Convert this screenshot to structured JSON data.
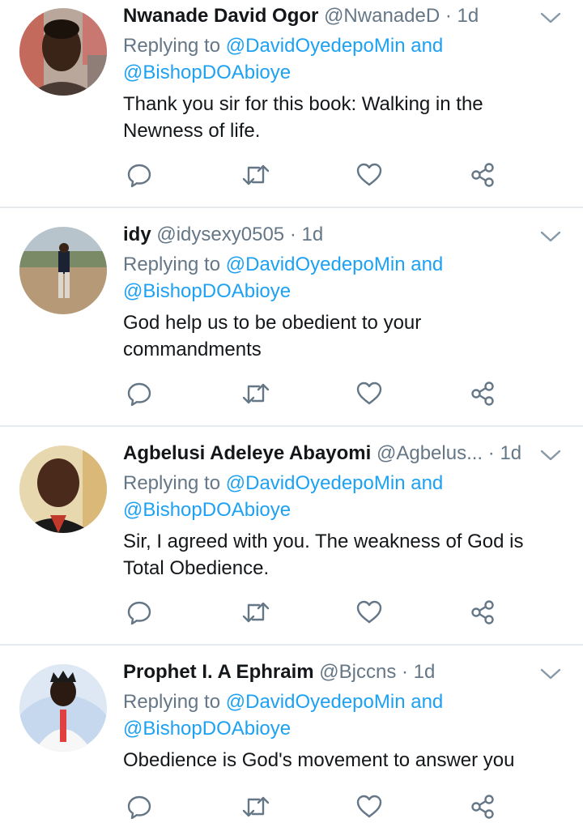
{
  "tweets": [
    {
      "name": "Nwanade David Ogor",
      "handle": "@NwanadeD",
      "sep": "·",
      "time": "1d",
      "reply_prefix": "Replying to ",
      "mention1": "@DavidOyedepoMin",
      "and": " and",
      "mention2": "@BishopDOAbioye",
      "body": "Thank you sir for this book: Walking in the Newness of life.",
      "avatar_icon": "avatar-photo"
    },
    {
      "name": "idy",
      "handle": "@idysexy0505",
      "sep": "·",
      "time": "1d",
      "reply_prefix": "Replying to ",
      "mention1": "@DavidOyedepoMin",
      "and": " and",
      "mention2": "@BishopDOAbioye",
      "body": "God help us to be obedient to your commandments",
      "avatar_icon": "avatar-photo"
    },
    {
      "name": "Agbelusi Adeleye Abayomi",
      "handle": "@Agbelus...",
      "sep": "·",
      "time": "1d",
      "reply_prefix": "Replying to ",
      "mention1": "@DavidOyedepoMin",
      "and": " and",
      "mention2": "@BishopDOAbioye",
      "body": "Sir, I agreed with you. The weakness of God is Total Obedience.",
      "avatar_icon": "avatar-photo"
    },
    {
      "name": "Prophet I. A Ephraim",
      "handle": "@Bjccns",
      "sep": "·",
      "time": "1d",
      "reply_prefix": "Replying to ",
      "mention1": "@DavidOyedepoMin",
      "and": " and",
      "mention2": "@BishopDOAbioye",
      "body": "Obedience is God's movement to answer you",
      "avatar_icon": "avatar-photo"
    }
  ],
  "icons": {
    "reply": "reply-icon",
    "retweet": "retweet-icon",
    "like": "like-icon",
    "share": "share-icon",
    "menu": "chevron-down-icon"
  },
  "colors": {
    "text": "#14171a",
    "muted": "#657786",
    "link": "#1da1f2",
    "divider": "#e6ecf0"
  }
}
